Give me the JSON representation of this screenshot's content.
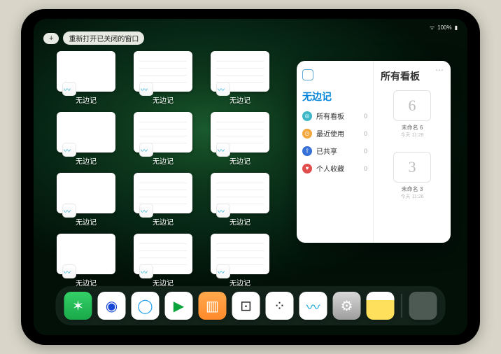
{
  "status": {
    "battery": "100%"
  },
  "topbar": {
    "plus": "+",
    "reopen": "重新打开已关闭的窗口"
  },
  "task_label": "无边记",
  "thumbs": [
    {
      "v": "blank"
    },
    {
      "v": "grid"
    },
    {
      "v": "grid"
    },
    {
      "v": "blank"
    },
    {
      "v": "grid"
    },
    {
      "v": "grid"
    },
    {
      "v": "blank"
    },
    {
      "v": "grid"
    },
    {
      "v": "grid"
    },
    {
      "v": "blank"
    },
    {
      "v": "grid"
    },
    {
      "v": "grid"
    }
  ],
  "panel": {
    "sidebar_title": "无边记",
    "content_title": "所有看板",
    "menu": [
      {
        "icon": "a",
        "glyph": "◎",
        "label": "所有看板",
        "count": "0"
      },
      {
        "icon": "b",
        "glyph": "◷",
        "label": "最近使用",
        "count": "0"
      },
      {
        "icon": "c",
        "glyph": "⇧",
        "label": "已共享",
        "count": "0"
      },
      {
        "icon": "d",
        "glyph": "♥",
        "label": "个人收藏",
        "count": "0"
      }
    ],
    "boards": [
      {
        "sketch": "6",
        "name": "未命名 6",
        "time": "今天 11:28"
      },
      {
        "sketch": "3",
        "name": "未命名 3",
        "time": "今天 11:26"
      }
    ]
  },
  "dock": {
    "apps": [
      {
        "cls": "wechat",
        "glyph": "✶",
        "name": "wechat"
      },
      {
        "cls": "browser",
        "glyph": "◉",
        "name": "quark-browser"
      },
      {
        "cls": "qq",
        "glyph": "◯",
        "name": "qq-browser"
      },
      {
        "cls": "video",
        "glyph": "▶",
        "name": "tencent-video"
      },
      {
        "cls": "books",
        "glyph": "▥",
        "name": "books"
      },
      {
        "cls": "white",
        "glyph": "⊡",
        "name": "app-white-square"
      },
      {
        "cls": "white",
        "glyph": "⁘",
        "name": "app-dots"
      },
      {
        "cls": "freeform",
        "glyph": "〰",
        "name": "freeform"
      },
      {
        "cls": "settings",
        "glyph": "⚙",
        "name": "settings"
      },
      {
        "cls": "notes",
        "glyph": "",
        "name": "notes"
      }
    ]
  }
}
